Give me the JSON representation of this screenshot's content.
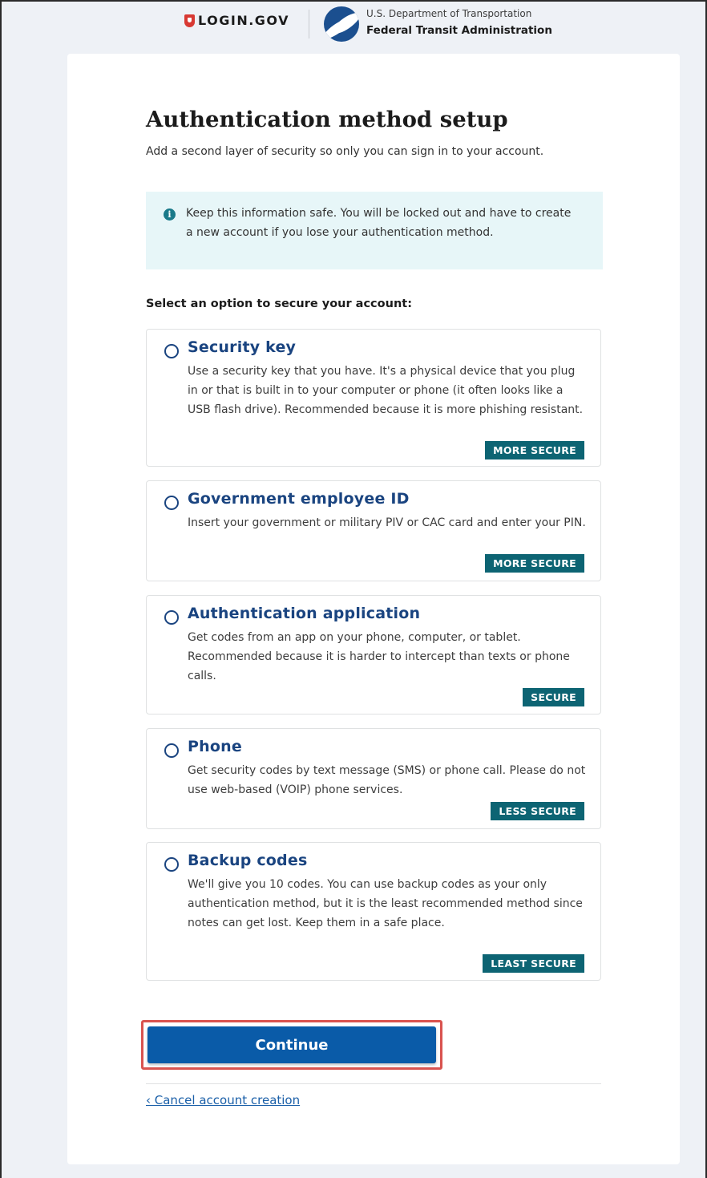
{
  "header": {
    "logo_text": "LOGIN.GOV",
    "agency_department": "U.S. Department of Transportation",
    "agency_name": "Federal Transit Administration"
  },
  "page": {
    "title": "Authentication method setup",
    "intro": "Add a second layer of security so only you can sign in to your account.",
    "alert": "Keep this information safe. You will be locked out and have to create a new account if you lose your authentication method.",
    "prompt": "Select an option to secure your account:"
  },
  "options": [
    {
      "title": "Security key",
      "description": "Use a security key that you have. It's a physical device that you plug in or that is built in to your computer or phone (it often looks like a USB flash drive). Recommended because it is more phishing resistant.",
      "badge": "MORE SECURE",
      "selected": false
    },
    {
      "title": "Government employee ID",
      "description": "Insert your government or military PIV or CAC card and enter your PIN.",
      "badge": "MORE SECURE",
      "selected": false
    },
    {
      "title": "Authentication application",
      "description": "Get codes from an app on your phone, computer, or tablet. Recommended because it is harder to intercept than texts or phone calls.",
      "badge": "SECURE",
      "selected": false
    },
    {
      "title": "Phone",
      "description": "Get security codes by text message (SMS) or phone call. Please do not use web-based (VOIP) phone services.",
      "badge": "LESS SECURE",
      "selected": false
    },
    {
      "title": "Backup codes",
      "description": "We'll give you 10 codes. You can use backup codes as your only authentication method, but it is the least recommended method since notes can get lost. Keep them in a safe place.",
      "badge": "LEAST SECURE",
      "selected": false
    }
  ],
  "actions": {
    "continue_label": "Continue",
    "cancel_label": "‹ Cancel account creation"
  },
  "colors": {
    "primary": "#0a5ba8",
    "title_blue": "#1a4480",
    "badge_teal": "#0d6473",
    "alert_bg": "#e7f6f8",
    "highlight": "#d9534f"
  },
  "icons": [
    "login-shield-icon",
    "dot-logo-icon",
    "info-icon"
  ]
}
